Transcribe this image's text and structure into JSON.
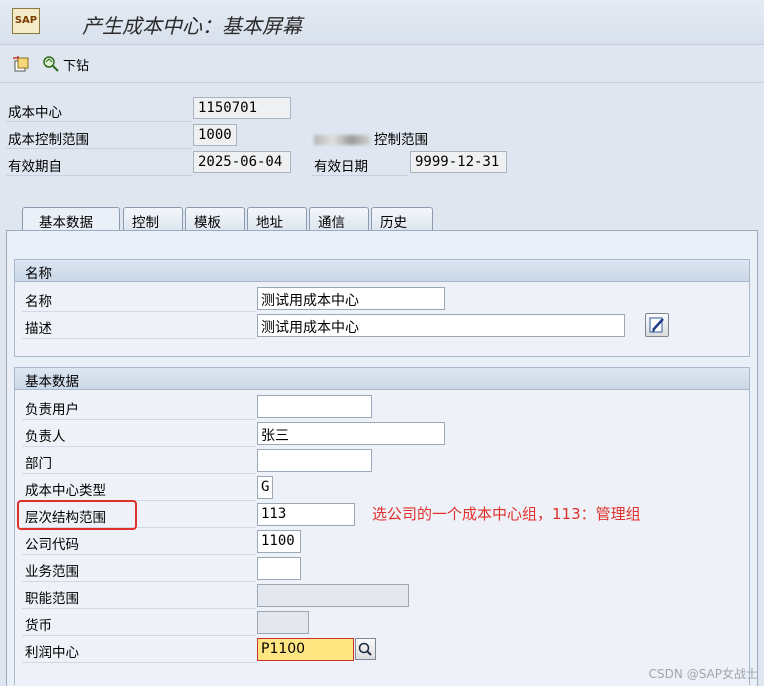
{
  "window": {
    "title": "产生成本中心：基本屏幕"
  },
  "toolbar": {
    "drilldown_label": "下钻"
  },
  "header_fields": {
    "cost_center": {
      "label": "成本中心",
      "value": "1150701"
    },
    "controlling_area": {
      "label": "成本控制范围",
      "value": "1000",
      "desc_suffix": "控制范围"
    },
    "valid_from": {
      "label": "有效期自",
      "value": "2025-06-04"
    },
    "valid_to": {
      "label": "有效日期",
      "value": "9999-12-31"
    }
  },
  "tabs": [
    "基本数据",
    "控制",
    "模板",
    "地址",
    "通信",
    "历史"
  ],
  "names_group": {
    "title": "名称",
    "name": {
      "label": "名称",
      "value": "测试用成本中心"
    },
    "description": {
      "label": "描述",
      "value": "测试用成本中心"
    }
  },
  "basic_group": {
    "title": "基本数据",
    "fields": [
      {
        "label": "负责用户",
        "value": ""
      },
      {
        "label": "负责人",
        "value": "张三"
      },
      {
        "label": "部门",
        "value": ""
      },
      {
        "label": "成本中心类型",
        "value": "G"
      },
      {
        "label": "层次结构范围",
        "value": "113"
      },
      {
        "label": "公司代码",
        "value": "1100"
      },
      {
        "label": "业务范围",
        "value": ""
      },
      {
        "label": "职能范围",
        "value": ""
      },
      {
        "label": "货币",
        "value": ""
      },
      {
        "label": "利润中心",
        "value": "P1100"
      }
    ]
  },
  "annotation": {
    "text": "选公司的一个成本中心组，113：管理组",
    "color": "#e0302b"
  },
  "watermark": "CSDN @SAP女战士",
  "icons": [
    "sap-app-icon",
    "other-object-icon",
    "drilldown-icon",
    "edit-description-icon",
    "search-help-icon"
  ]
}
